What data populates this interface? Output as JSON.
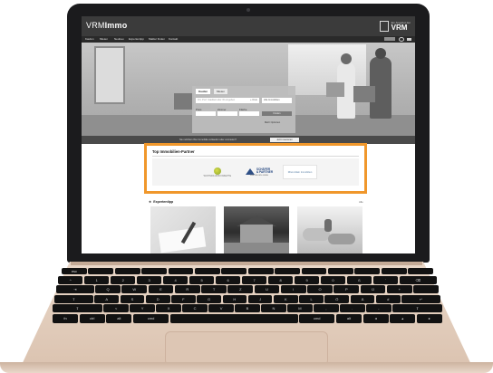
{
  "site": {
    "logo": {
      "light": "VRM",
      "bold": "Immo"
    },
    "brand": {
      "small": "Ein Angebot der",
      "name": "VRM"
    },
    "nav": [
      "Kaufen",
      "Mieten",
      "Neubau",
      "Expertentipp",
      "Makler finden",
      "Kontakt"
    ]
  },
  "search": {
    "tabs": [
      "Kaufen",
      "Mieten"
    ],
    "location_placeholder": "Ort, PLZ, Stadtteil oder ID eingeben",
    "radius": "+ 0 km",
    "property_type": "Alle Immobilien",
    "labels": [
      "Preis",
      "Zimmer",
      "Fläche"
    ],
    "submit": "Finden",
    "more": "Mehr Optionen"
  },
  "cta": {
    "text": "Sie möchten Ihre Immobilie verkaufen oder vermieten?",
    "button": "Jetzt inserieren"
  },
  "partners": {
    "title": "Top Immobilien-Partner",
    "logos": [
      {
        "name": "WOHNRAUMKONZEPTE",
        "icon": "circle-logo-icon"
      },
      {
        "name": "SCHÄFER",
        "sub": "& PARTNER",
        "sub2": "IMMOBILIEN GMBH",
        "icon": "triangle-logo-icon"
      },
      {
        "name": "Rhein-Main Immobilien",
        "icon": "text-logo"
      }
    ],
    "highlight_color": "#f0972b"
  },
  "experts": {
    "title": "Expertentipp",
    "all_link": "Alle",
    "cards": [
      "contract-signing-photo",
      "house-photo",
      "key-handover-photo"
    ]
  },
  "keyboard": {
    "rows": [
      [
        "esc",
        "",
        "",
        "",
        "",
        "",
        "",
        "",
        "",
        "",
        "",
        "",
        "",
        ""
      ],
      [
        "^",
        "1",
        "2",
        "3",
        "4",
        "5",
        "6",
        "7",
        "8",
        "9",
        "0",
        "ß",
        "´",
        "⌫"
      ],
      [
        "⇥",
        "Q",
        "W",
        "E",
        "R",
        "T",
        "Z",
        "U",
        "I",
        "O",
        "P",
        "Ü",
        "+",
        ""
      ],
      [
        "⇪",
        "A",
        "S",
        "D",
        "F",
        "G",
        "H",
        "J",
        "K",
        "L",
        "Ö",
        "Ä",
        "#",
        "↵"
      ],
      [
        "⇧",
        "<",
        "Y",
        "X",
        "C",
        "V",
        "B",
        "N",
        "M",
        ",",
        ".",
        "-",
        "⇧"
      ],
      [
        "fn",
        "ctrl",
        "alt",
        "cmd",
        "",
        "cmd",
        "alt",
        "◂",
        "▴",
        "▸"
      ]
    ]
  }
}
